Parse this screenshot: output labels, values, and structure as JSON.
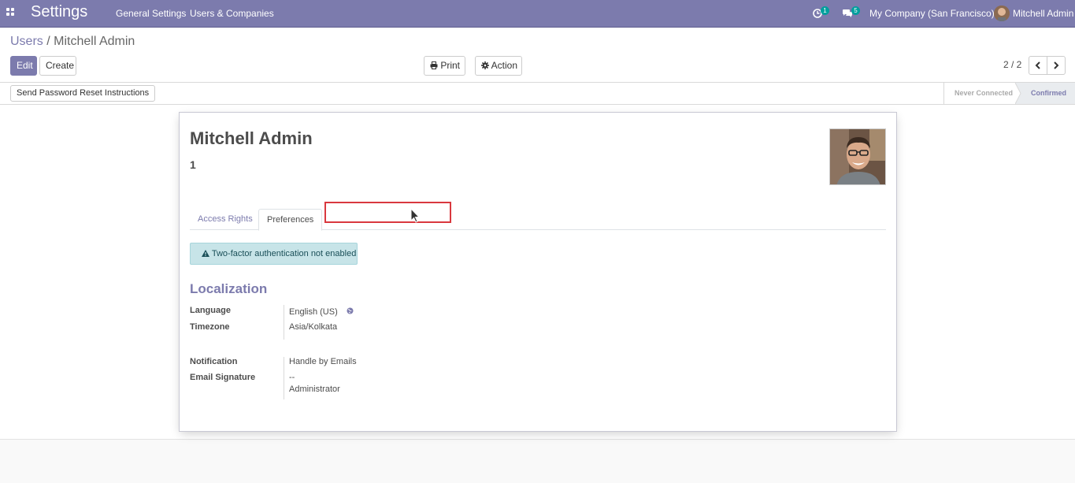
{
  "navbar": {
    "app_title": "Settings",
    "menus": [
      "General Settings",
      "Users & Companies"
    ],
    "activity_count": "1",
    "messages_count": "5",
    "company": "My Company (San Francisco)",
    "user": "Mitchell Admin"
  },
  "breadcrumb": {
    "parent": "Users",
    "separator": "/",
    "current": "Mitchell Admin"
  },
  "toolbar": {
    "edit_label": "Edit",
    "create_label": "Create",
    "print_label": "Print",
    "action_label": "Action",
    "pager_value": "2 / 2"
  },
  "statusbar": {
    "reset_password_label": "Send Password Reset Instructions",
    "stages": [
      "Never Connected",
      "Confirmed"
    ],
    "active_stage": "Confirmed"
  },
  "form": {
    "name": "Mitchell Admin",
    "login": "1",
    "tabs": [
      "Access Rights",
      "Preferences"
    ],
    "active_tab": "Preferences",
    "alert_text": "Two-factor authentication not enabled",
    "section_title": "Localization",
    "fields": {
      "language_label": "Language",
      "language_value": "English (US)",
      "timezone_label": "Timezone",
      "timezone_value": "Asia/Kolkata",
      "notification_label": "Notification",
      "notification_value": "Handle by Emails",
      "signature_label": "Email Signature",
      "signature_line1": "--",
      "signature_line2": "Administrator"
    }
  },
  "colors": {
    "brand": "#7c7bad",
    "badge": "#00a09d",
    "alert_bg": "#c7e4e8",
    "highlight": "#d9383e"
  }
}
